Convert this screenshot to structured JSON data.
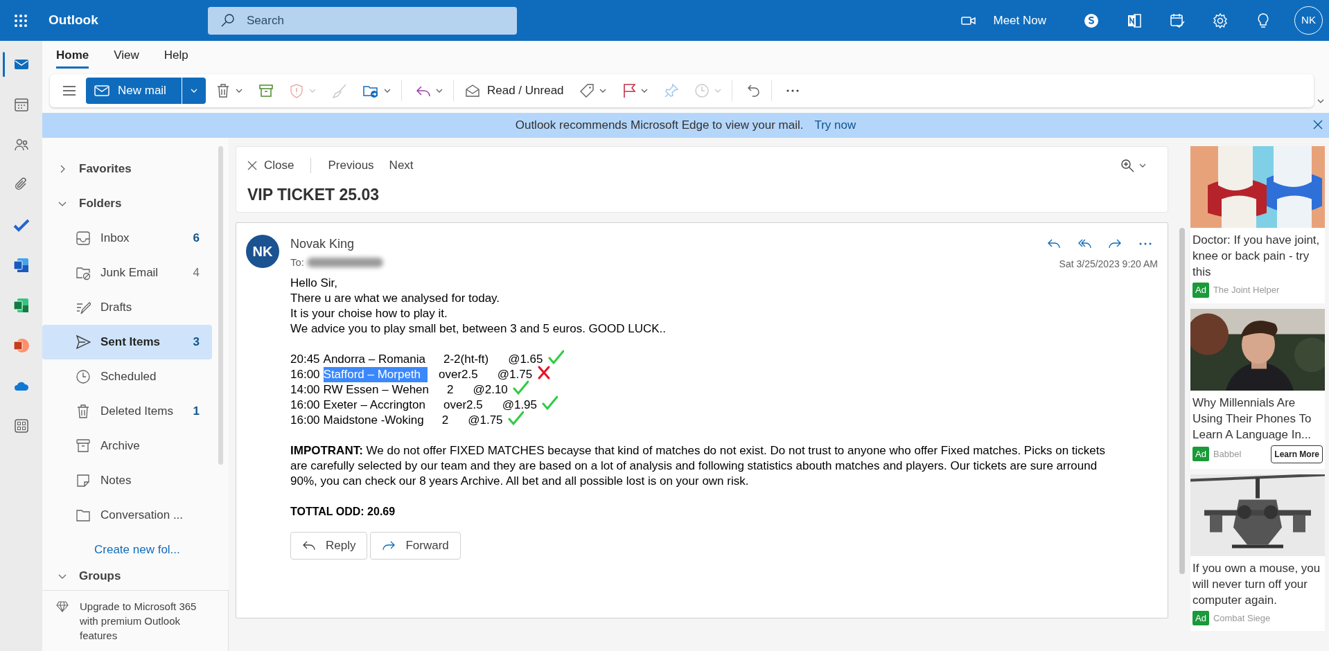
{
  "app": {
    "name": "Outlook"
  },
  "search": {
    "placeholder": "Search"
  },
  "header": {
    "meet_now": "Meet Now",
    "avatar": "NK"
  },
  "ribbon_tabs": [
    {
      "label": "Home",
      "selected": true
    },
    {
      "label": "View",
      "selected": false
    },
    {
      "label": "Help",
      "selected": false
    }
  ],
  "toolbar": {
    "new_mail": "New mail",
    "read_unread": "Read / Unread"
  },
  "banner": {
    "message": "Outlook recommends Microsoft Edge to view your mail.",
    "link": "Try now"
  },
  "folder_pane": {
    "sections": [
      {
        "label": "Favorites",
        "expanded": false
      },
      {
        "label": "Folders",
        "expanded": true
      }
    ],
    "folders": [
      {
        "kind": "inbox",
        "label": "Inbox",
        "count": "6",
        "unread": true,
        "selected": false
      },
      {
        "kind": "junk",
        "label": "Junk Email",
        "count": "4",
        "unread": false,
        "selected": false
      },
      {
        "kind": "drafts",
        "label": "Drafts",
        "selected": false
      },
      {
        "kind": "sent",
        "label": "Sent Items",
        "count": "3",
        "unread": true,
        "selected": true
      },
      {
        "kind": "scheduled",
        "label": "Scheduled",
        "selected": false
      },
      {
        "kind": "deleted",
        "label": "Deleted Items",
        "count": "1",
        "unread": true,
        "selected": false
      },
      {
        "kind": "archive",
        "label": "Archive",
        "selected": false
      },
      {
        "kind": "notes",
        "label": "Notes",
        "selected": false
      },
      {
        "kind": "folder",
        "label": "Conversation ...",
        "selected": false
      }
    ],
    "create_folder": "Create new fol...",
    "groups": "Groups",
    "upgrade": "Upgrade to Microsoft 365 with premium Outlook features"
  },
  "reading_header": {
    "close": "Close",
    "previous": "Previous",
    "next": "Next",
    "subject": "VIP TICKET 25.03"
  },
  "message": {
    "initials": "NK",
    "sender": "Novak King",
    "to_label": "To:",
    "date": "Sat 3/25/2023 9:20 AM",
    "intro": [
      "Hello Sir,",
      "There u are what we analysed for today.",
      "It is your choise how to play it.",
      "We advice you to play small bet, between 3 and 5 euros. GOOD LUCK.."
    ],
    "picks": [
      {
        "time": "20:45",
        "match": "Andorra – Romania",
        "highlighted": false,
        "market": "2-2(ht-ft)",
        "odd": "@1.65",
        "correct": true
      },
      {
        "time": "16:00",
        "match": "Stafford – Morpeth",
        "highlighted": true,
        "market": "over2.5",
        "odd": "@1.75",
        "correct": false
      },
      {
        "time": "14:00",
        "match": "RW Essen – Wehen",
        "highlighted": false,
        "market": "2",
        "odd": "@2.10",
        "correct": true
      },
      {
        "time": "16:00",
        "match": "Exeter – Accrington",
        "highlighted": false,
        "market": "over2.5",
        "odd": "@1.95",
        "correct": true
      },
      {
        "time": "16:00",
        "match": "Maidstone -Woking",
        "highlighted": false,
        "market": "2",
        "odd": "@1.75",
        "correct": true
      }
    ],
    "notice": "**IMPOTRANT:** We do not offer FIXED MATCHES becayse that kind of matches do not exist. Do not trust to anyone who offer Fixed matches. Picks on tickets are carefully selected by our team and they are based on a lot of analysis and following statistics abouth matches and players. Our tickets are sure arround 90%, you can check our 8 years Archive. All bet and all possible lost is on your own risk.",
    "total": "TOTTAL ODD: 20.69",
    "actions": [
      "Reply",
      "Forward"
    ]
  },
  "ads": [
    {
      "headline": "Doctor: If you have joint, knee or back pain - try this",
      "badge": "Ad",
      "sponsor": "The Joint Helper"
    },
    {
      "headline": "Why Millennials Are Using Their Phones To Learn A Language In...",
      "badge": "Ad",
      "sponsor": "Babbel",
      "cta": "Learn More"
    },
    {
      "headline": "If you own a mouse, you will never turn off your computer again.",
      "badge": "Ad",
      "sponsor": "Combat Siege"
    }
  ]
}
